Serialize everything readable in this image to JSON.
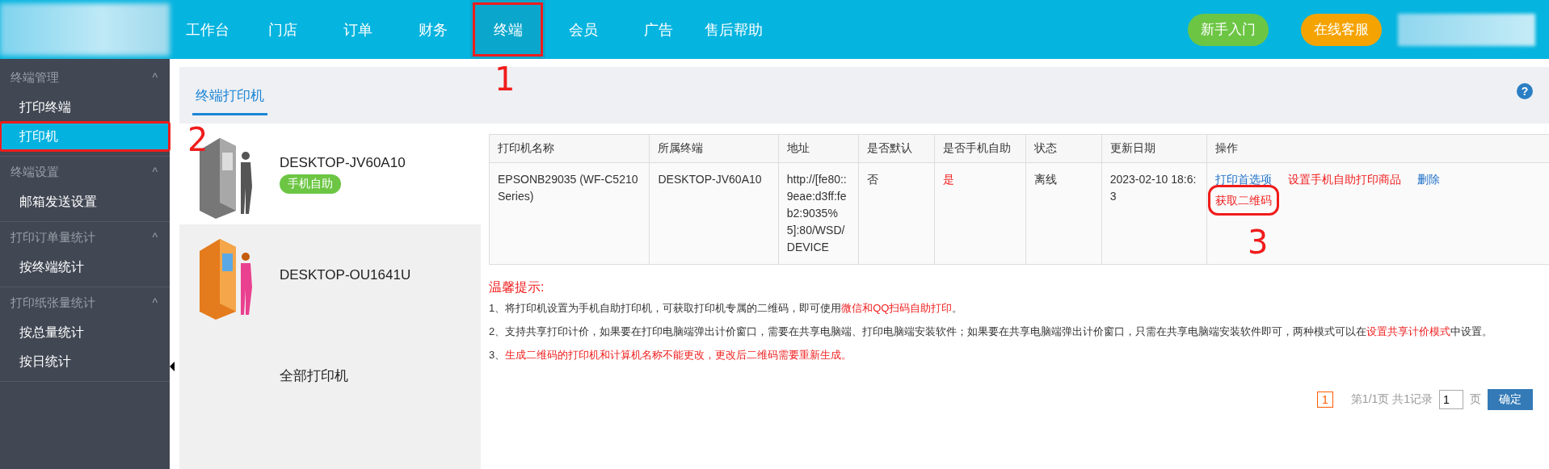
{
  "nav": {
    "items": [
      {
        "label": "工作台",
        "selected": false
      },
      {
        "label": "门店",
        "selected": false
      },
      {
        "label": "订单",
        "selected": false
      },
      {
        "label": "财务",
        "selected": false
      },
      {
        "label": "终端",
        "selected": true,
        "annotation": "1"
      },
      {
        "label": "会员",
        "selected": false
      },
      {
        "label": "广告",
        "selected": false
      },
      {
        "label": "售后帮助",
        "selected": false
      }
    ],
    "buttons": [
      {
        "label": "新手入门",
        "color": "#6cc644"
      },
      {
        "label": "在线客服",
        "color": "#f5a300"
      }
    ]
  },
  "sidebar": {
    "groups": [
      {
        "title": "终端管理",
        "caret": "^",
        "expanded": true,
        "items": [
          {
            "label": "打印终端",
            "selected": false
          },
          {
            "label": "打印机",
            "selected": true,
            "annotation": "2"
          }
        ]
      },
      {
        "title": "终端设置",
        "caret": "^",
        "expanded": true,
        "items": [
          {
            "label": "邮箱发送设置",
            "selected": false
          }
        ]
      },
      {
        "title": "打印订单量统计",
        "caret": "^",
        "expanded": true,
        "items": [
          {
            "label": "按终端统计",
            "selected": false
          }
        ]
      },
      {
        "title": "打印纸张量统计",
        "caret": "^",
        "expanded": true,
        "items": [
          {
            "label": "按总量统计",
            "selected": false
          },
          {
            "label": "按日统计",
            "selected": false
          }
        ]
      }
    ]
  },
  "tabs": [
    {
      "label": "终端打印机",
      "selected": true
    }
  ],
  "help": "?",
  "printers": [
    {
      "name": "DESKTOP-JV60A10",
      "badge": "手机自助",
      "kind": "gray",
      "selected": true
    },
    {
      "name": "DESKTOP-OU1641U",
      "kind": "orange",
      "selected": false
    },
    {
      "name": "全部打印机",
      "kind": "none",
      "selected": false
    }
  ],
  "table": {
    "columns": [
      "打印机名称",
      "所属终端",
      "地址",
      "是否默认",
      "是否手机自助",
      "状态",
      "更新日期",
      "操作"
    ],
    "rows": [
      {
        "cells": [
          {
            "text": "EPSONB29035 (WF-C5210 Series)",
            "highlight": false
          },
          {
            "text": "DESKTOP-JV60A10",
            "highlight": false
          },
          {
            "text": "http://[fe80::9eae:d3ff:feb2:9035%5]:80/WSD/DEVICE",
            "highlight": false
          },
          {
            "text": "否",
            "highlight": false
          },
          {
            "text": "是",
            "highlight": true
          },
          {
            "text": "离线",
            "highlight": false
          },
          {
            "text": "2023-02-10 18:6:3",
            "highlight": false
          }
        ],
        "actions": [
          {
            "label": "打印首选项",
            "kind": "link"
          },
          {
            "label": "设置手机自助打印商品",
            "kind": "danger"
          },
          {
            "label": "删除",
            "kind": "link"
          },
          {
            "label": "获取二维码",
            "kind": "danger",
            "annotation": "3"
          }
        ]
      }
    ]
  },
  "notes": {
    "title": "温馨提示:",
    "items": [
      [
        {
          "text": "1、将打印机设置为手机自助打印机，可获取打印机专属的二维码，即可使用",
          "highlight": false
        },
        {
          "text": "微信和QQ扫码自助打印",
          "highlight": true
        },
        {
          "text": "。",
          "highlight": false
        }
      ],
      [
        {
          "text": "2、支持共享打印计价，如果要在打印电脑端弹出计价窗口，需要在共享电脑端、打印电脑端安装软件；如果要在共享电脑端弹出计价窗口，只需在共享电脑端安装软件即可，两种模式可以在",
          "highlight": false
        },
        {
          "text": "设置共享计价模式",
          "highlight": true
        },
        {
          "text": "中设置。",
          "highlight": false
        }
      ],
      [
        {
          "text": "3、",
          "highlight": false
        },
        {
          "text": "生成二维码的打印机和计算机名称不能更改，更改后二维码需要重新生成。",
          "highlight": true
        }
      ]
    ]
  },
  "pagination": {
    "pages": [
      {
        "label": "1",
        "selected": true
      }
    ],
    "summary": "第1/1页 共1记录",
    "input": "1",
    "unit": "页",
    "button": "确定"
  }
}
